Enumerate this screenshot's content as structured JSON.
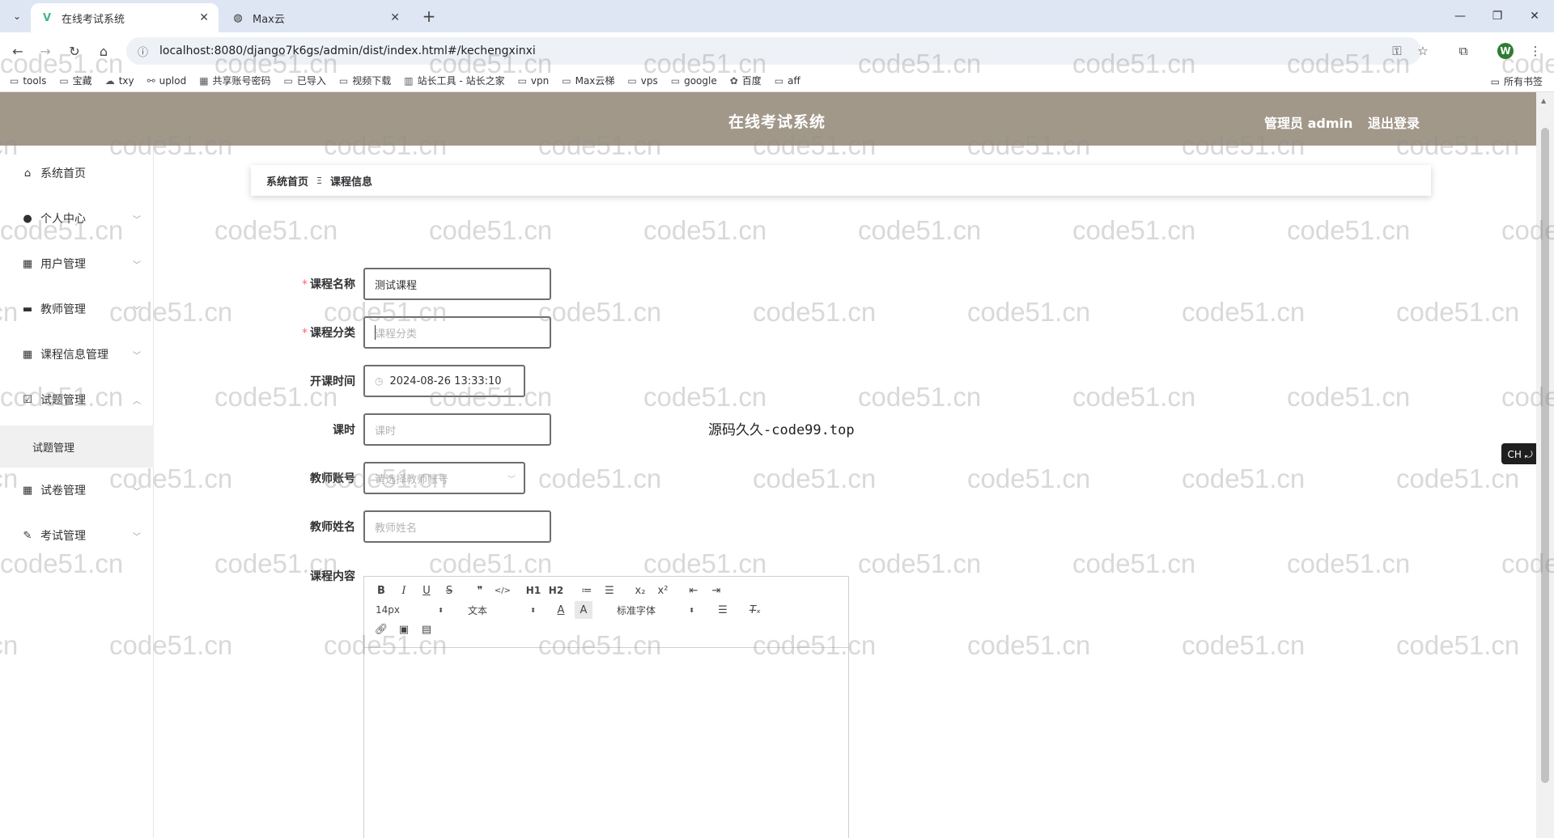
{
  "browser": {
    "tabs": [
      {
        "title": "在线考试系统",
        "icon": "vue-logo-icon",
        "active": true
      },
      {
        "title": "Max云",
        "icon": "globe-icon",
        "active": false
      }
    ],
    "url": "localhost:8080/django7k6gs/admin/dist/index.html#/kechengxinxi",
    "profile_initial": "W",
    "bookmarks": [
      {
        "label": "tools",
        "icon": "folder-icon"
      },
      {
        "label": "宝藏",
        "icon": "folder-icon"
      },
      {
        "label": "txy",
        "icon": "cloud-icon"
      },
      {
        "label": "uplod",
        "icon": "link-icon"
      },
      {
        "label": "共享账号密码",
        "icon": "sheet-icon"
      },
      {
        "label": "已导入",
        "icon": "folder-icon"
      },
      {
        "label": "视频下载",
        "icon": "folder-icon"
      },
      {
        "label": "站长工具 - 站长之家",
        "icon": "site-icon"
      },
      {
        "label": "vpn",
        "icon": "folder-icon"
      },
      {
        "label": "Max云梯",
        "icon": "folder-icon"
      },
      {
        "label": "vps",
        "icon": "folder-icon"
      },
      {
        "label": "google",
        "icon": "folder-icon"
      },
      {
        "label": "百度",
        "icon": "baidu-icon"
      },
      {
        "label": "aff",
        "icon": "folder-icon"
      }
    ],
    "all_bookmarks": "所有书签"
  },
  "header": {
    "title": "在线考试系统",
    "user": "管理员 admin",
    "logout": "退出登录"
  },
  "sidebar": {
    "items": [
      {
        "label": "系统首页",
        "icon": "home-icon",
        "has_arrow": false
      },
      {
        "label": "个人中心",
        "icon": "user-icon",
        "has_arrow": true
      },
      {
        "label": "用户管理",
        "icon": "grid-icon",
        "has_arrow": true
      },
      {
        "label": "教师管理",
        "icon": "monitor-icon",
        "has_arrow": true
      },
      {
        "label": "课程信息管理",
        "icon": "grid-icon",
        "has_arrow": true
      },
      {
        "label": "试题管理",
        "icon": "checkbox-icon",
        "has_arrow": true,
        "expanded": true
      },
      {
        "label": "试卷管理",
        "icon": "grid-icon",
        "has_arrow": true
      },
      {
        "label": "考试管理",
        "icon": "exam-icon",
        "has_arrow": true
      }
    ],
    "submenu": {
      "label": "试题管理"
    }
  },
  "breadcrumb": {
    "home": "系统首页",
    "separator": "Ξ",
    "current": "课程信息"
  },
  "form": {
    "course_name": {
      "label": "课程名称",
      "required": true,
      "value": "测试课程"
    },
    "course_category": {
      "label": "课程分类",
      "required": true,
      "placeholder": "课程分类"
    },
    "start_time": {
      "label": "开课时间",
      "value": "2024-08-26 13:33:10"
    },
    "hours": {
      "label": "课时",
      "placeholder": "课时"
    },
    "teacher_account": {
      "label": "教师账号",
      "placeholder": "请选择教师账号"
    },
    "teacher_name": {
      "label": "教师姓名",
      "placeholder": "教师姓名"
    },
    "content": {
      "label": "课程内容"
    }
  },
  "editor": {
    "font_size": "14px",
    "header_select": "文本",
    "font_family": "标准字体",
    "buttons": [
      "B",
      "I",
      "U",
      "S",
      "❞",
      "</>",
      "H1",
      "H2",
      "≔",
      "☰",
      "x₂",
      "x²",
      "⇤",
      "⇥"
    ]
  },
  "overlay_text": "源码久久-code99.top",
  "ime": "CH ⤾ 简",
  "watermark": "code51.cn"
}
